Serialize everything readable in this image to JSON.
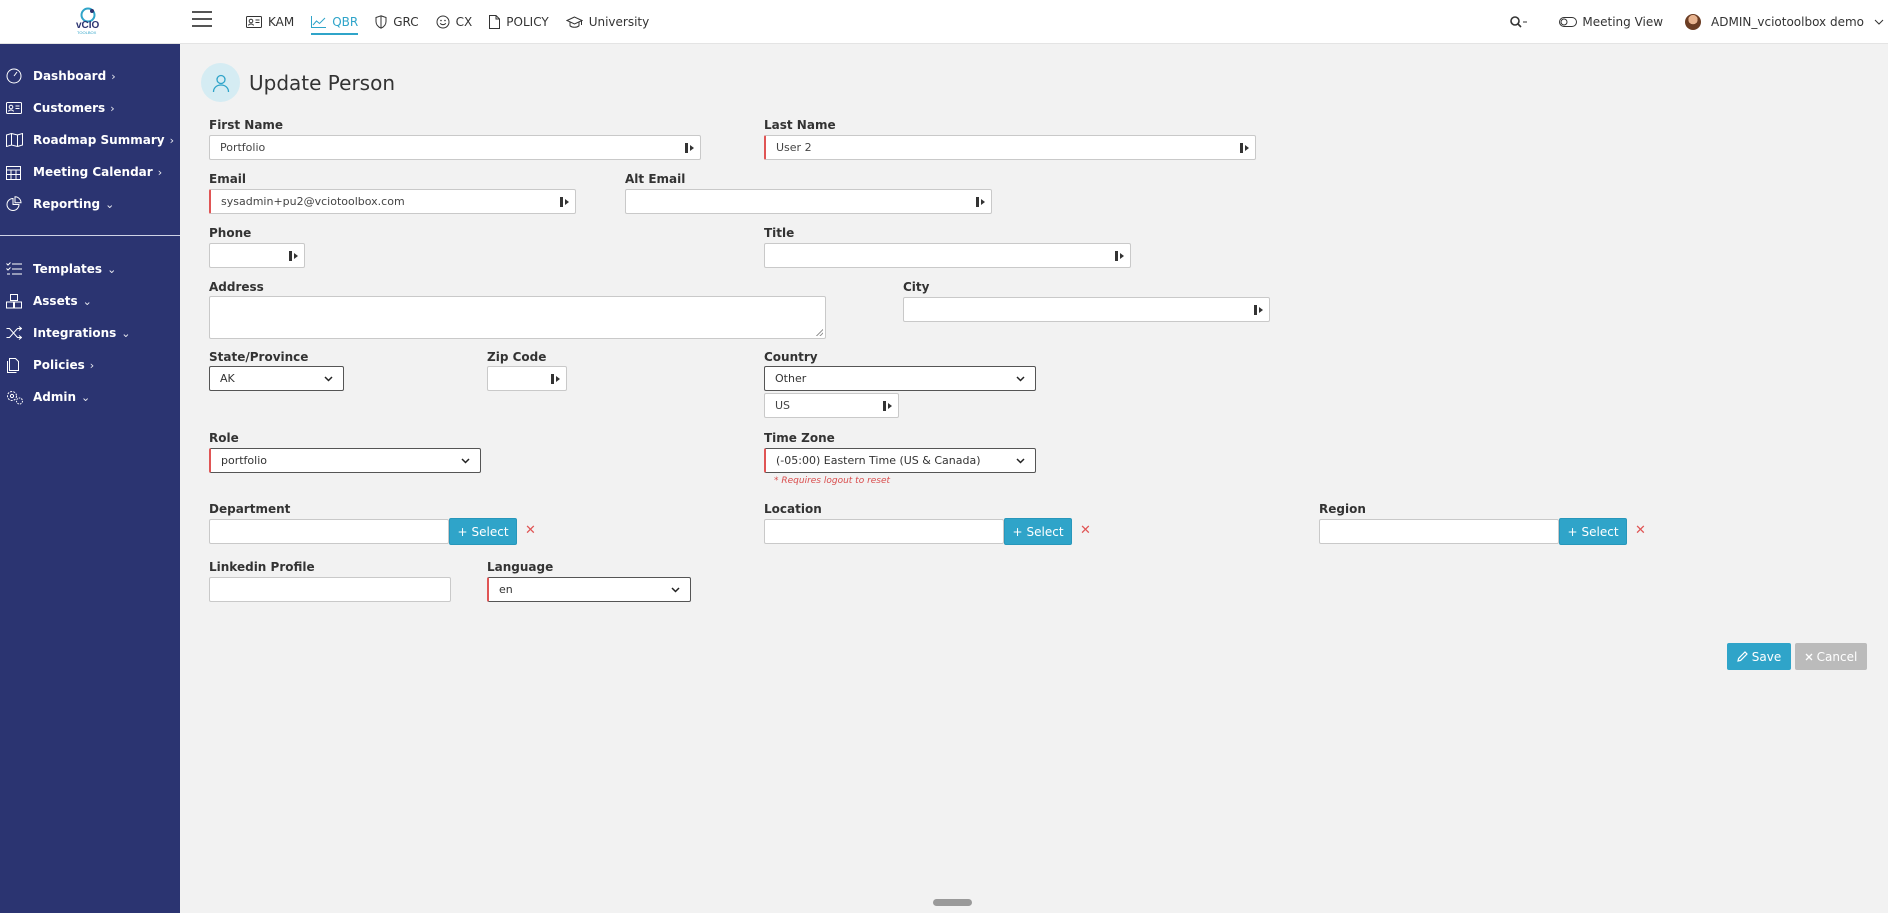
{
  "topnav": {
    "items": [
      {
        "label": "KAM",
        "icon": "id-card-icon"
      },
      {
        "label": "QBR",
        "icon": "line-chart-icon",
        "active": true
      },
      {
        "label": "GRC",
        "icon": "shield-icon"
      },
      {
        "label": "CX",
        "icon": "smiley-icon"
      },
      {
        "label": "POLICY",
        "icon": "document-icon"
      },
      {
        "label": "University",
        "icon": "graduation-cap-icon"
      }
    ],
    "meeting_view": "Meeting View",
    "user_name": "ADMIN_vciotoolbox demo"
  },
  "sidebar": {
    "items": [
      {
        "label": "Dashboard",
        "chevron": "›"
      },
      {
        "label": "Customers",
        "chevron": "›"
      },
      {
        "label": "Roadmap Summary",
        "chevron": "›"
      },
      {
        "label": "Meeting Calendar",
        "chevron": "›"
      },
      {
        "label": "Reporting",
        "chevron": "⌄"
      },
      {
        "label": "Templates",
        "chevron": "⌄"
      },
      {
        "label": "Assets",
        "chevron": "⌄"
      },
      {
        "label": "Integrations",
        "chevron": "⌄"
      },
      {
        "label": "Policies",
        "chevron": "›"
      },
      {
        "label": "Admin",
        "chevron": "⌄"
      }
    ]
  },
  "page": {
    "title": "Update Person"
  },
  "form": {
    "first_name": {
      "label": "First Name",
      "value": "Portfolio"
    },
    "last_name": {
      "label": "Last Name",
      "value": "User 2"
    },
    "email": {
      "label": "Email",
      "value": "sysadmin+pu2@vciotoolbox.com"
    },
    "alt_email": {
      "label": "Alt Email",
      "value": ""
    },
    "phone": {
      "label": "Phone",
      "value": ""
    },
    "title": {
      "label": "Title",
      "value": ""
    },
    "address": {
      "label": "Address",
      "value": ""
    },
    "city": {
      "label": "City",
      "value": ""
    },
    "state": {
      "label": "State/Province",
      "value": "AK"
    },
    "zip": {
      "label": "Zip Code",
      "value": ""
    },
    "country": {
      "label": "Country",
      "value": "Other",
      "other_value": "US"
    },
    "role": {
      "label": "Role",
      "value": "portfolio"
    },
    "timezone": {
      "label": "Time Zone",
      "value": "(-05:00) Eastern Time (US & Canada)",
      "note": "* Requires logout to reset"
    },
    "department": {
      "label": "Department",
      "value": "",
      "select_label": "Select"
    },
    "location": {
      "label": "Location",
      "value": "",
      "select_label": "Select"
    },
    "region": {
      "label": "Region",
      "value": "",
      "select_label": "Select"
    },
    "linkedin": {
      "label": "Linkedin Profile",
      "value": ""
    },
    "language": {
      "label": "Language",
      "value": "en"
    },
    "clear_mark": "✕"
  },
  "actions": {
    "save": "Save",
    "cancel": "Cancel"
  },
  "colors": {
    "sidebar": "#2b3471",
    "accent": "#2fa4c9",
    "required": "#e05555"
  }
}
